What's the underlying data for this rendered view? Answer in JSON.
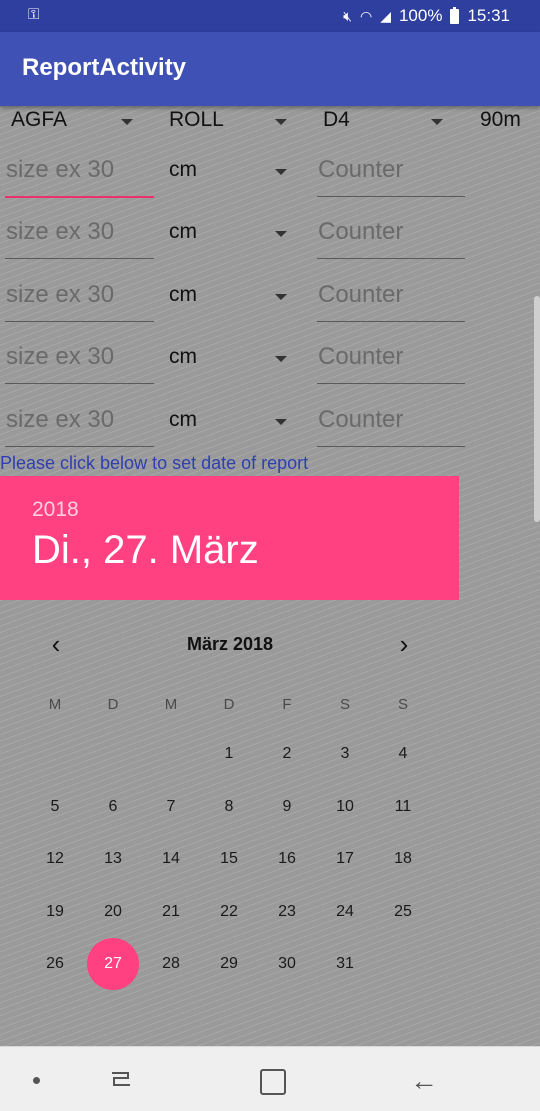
{
  "status_bar": {
    "time": "15:31",
    "battery": "100%"
  },
  "app": {
    "title": "ReportActivity"
  },
  "spinners": {
    "brand": "AGFA",
    "format": "ROLL",
    "type": "D4",
    "length": "90m"
  },
  "size_rows": [
    {
      "size_placeholder": "size ex 30",
      "unit": "cm",
      "counter_placeholder": "Counter"
    },
    {
      "size_placeholder": "size ex 30",
      "unit": "cm",
      "counter_placeholder": "Counter"
    },
    {
      "size_placeholder": "size ex 30",
      "unit": "cm",
      "counter_placeholder": "Counter"
    },
    {
      "size_placeholder": "size ex 30",
      "unit": "cm",
      "counter_placeholder": "Counter"
    },
    {
      "size_placeholder": "size ex 30",
      "unit": "cm",
      "counter_placeholder": "Counter"
    }
  ],
  "hint": "Please click below to set date of report",
  "date_picker": {
    "header_year": "2018",
    "header_date": "Di., 27. März",
    "month_label": "März 2018",
    "weekdays": [
      "M",
      "D",
      "M",
      "D",
      "F",
      "S",
      "S"
    ],
    "first_weekday_index": 3,
    "days_in_month": 31,
    "selected_day": 27,
    "accent_color": "#ff4081"
  },
  "colors": {
    "status_bar": "#2f3fa0",
    "app_bar": "#3f51b5",
    "accent": "#ff4081"
  },
  "icons": {
    "status_left": "key-icon",
    "prev": "chevron-left-icon",
    "next": "chevron-right-icon"
  }
}
